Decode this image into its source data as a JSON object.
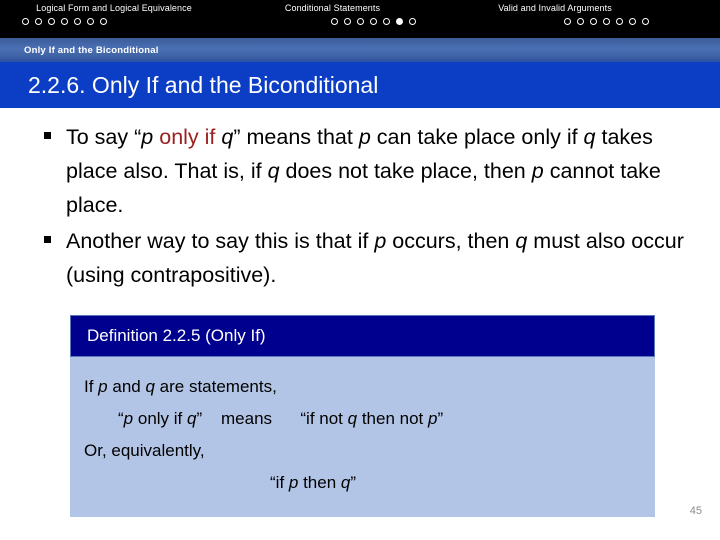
{
  "topnav": {
    "sections": [
      {
        "label": "Logical Form and Logical Equivalence",
        "dots": 7,
        "active_index": -1
      },
      {
        "label": "Conditional Statements",
        "dots": 7,
        "active_index": 5
      },
      {
        "label": "Valid and Invalid Arguments",
        "dots": 7,
        "active_index": -1
      }
    ]
  },
  "subtitle_bar": {
    "text": "Only If and the Biconditional"
  },
  "title_bar": {
    "text": "2.2.6. Only If and the Biconditional"
  },
  "bullets": [
    {
      "marker": "square-bullet",
      "segments": [
        {
          "text": "To say “",
          "style": "normal"
        },
        {
          "text": "p",
          "style": "italic"
        },
        {
          "text": " ",
          "style": "normal"
        },
        {
          "text": "only if",
          "style": "red"
        },
        {
          "text": " ",
          "style": "normal"
        },
        {
          "text": "q",
          "style": "italic"
        },
        {
          "text": "” means that ",
          "style": "normal"
        },
        {
          "text": "p",
          "style": "italic"
        },
        {
          "text": " can take place only if ",
          "style": "normal"
        },
        {
          "text": "q",
          "style": "italic"
        },
        {
          "text": " takes place also. That is, if ",
          "style": "normal"
        },
        {
          "text": "q",
          "style": "italic"
        },
        {
          "text": " does not take place, then ",
          "style": "normal"
        },
        {
          "text": "p",
          "style": "italic"
        },
        {
          "text": " cannot take place.",
          "style": "normal"
        }
      ]
    },
    {
      "marker": "square-bullet",
      "segments": [
        {
          "text": "Another way to say this is that if ",
          "style": "normal"
        },
        {
          "text": "p",
          "style": "italic"
        },
        {
          "text": " occurs, then ",
          "style": "normal"
        },
        {
          "text": "q",
          "style": "italic"
        },
        {
          "text": " must also occur (using contrapositive).",
          "style": "normal"
        }
      ]
    }
  ],
  "definition_box": {
    "header": "Definition 2.2.5 (Only If)",
    "lines": [
      {
        "indent": "none",
        "segments": [
          {
            "text": "If ",
            "style": "normal"
          },
          {
            "text": "p",
            "style": "italic"
          },
          {
            "text": " and ",
            "style": "normal"
          },
          {
            "text": "q",
            "style": "italic"
          },
          {
            "text": " are statements,",
            "style": "normal"
          }
        ]
      },
      {
        "indent": "one",
        "segments": [
          {
            "text": "“",
            "style": "normal"
          },
          {
            "text": "p",
            "style": "italic"
          },
          {
            "text": " only if ",
            "style": "normal"
          },
          {
            "text": "q",
            "style": "italic"
          },
          {
            "text": "”    means      “if not ",
            "style": "normal"
          },
          {
            "text": "q",
            "style": "italic"
          },
          {
            "text": " then not ",
            "style": "normal"
          },
          {
            "text": "p",
            "style": "italic"
          },
          {
            "text": "”",
            "style": "normal"
          }
        ]
      },
      {
        "indent": "none",
        "segments": [
          {
            "text": "Or, equivalently,",
            "style": "normal"
          }
        ]
      },
      {
        "indent": "two",
        "segments": [
          {
            "text": "“if ",
            "style": "normal"
          },
          {
            "text": "p",
            "style": "italic"
          },
          {
            "text": " then ",
            "style": "normal"
          },
          {
            "text": "q",
            "style": "italic"
          },
          {
            "text": "”",
            "style": "normal"
          }
        ]
      }
    ]
  },
  "page_number": "45",
  "colors": {
    "topbar_bg": "#000000",
    "subbar_blue": "#4a70b4",
    "title_blue": "#0b3ec4",
    "def_header_navy": "#00008f",
    "def_body_blue": "#b3c5e7",
    "accent_red": "#9c2020",
    "page_number_gray": "#8c8c8c"
  }
}
